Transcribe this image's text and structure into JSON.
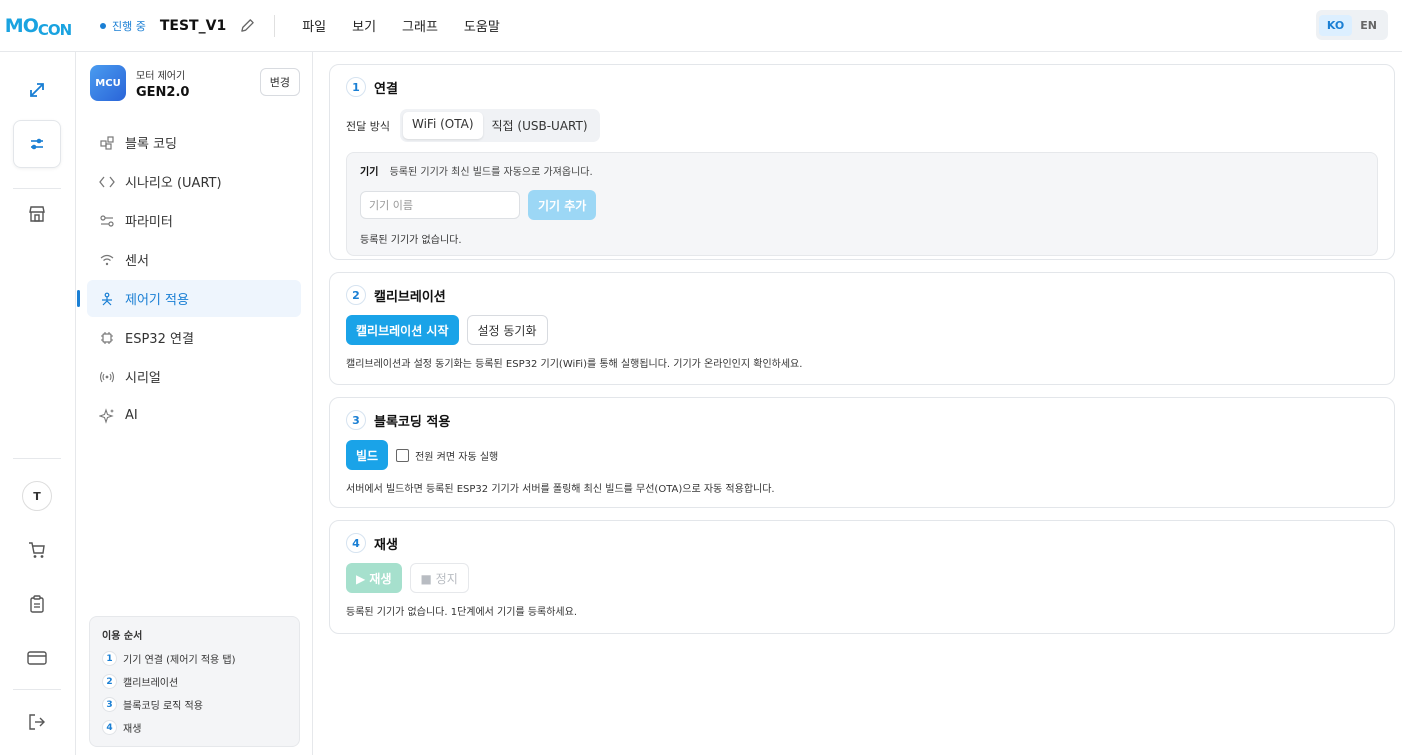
{
  "header": {
    "logo": "MOCON",
    "status": "진행 중",
    "project_title": "TEST_V1",
    "menu": [
      "파일",
      "보기",
      "그래프",
      "도움말"
    ],
    "lang": {
      "ko": "KO",
      "en": "EN",
      "active": "KO"
    }
  },
  "rail": {
    "items": [
      "chart-icon",
      "sliders-icon",
      "store-icon",
      "cart-icon",
      "clipboard-icon",
      "card-icon",
      "logout-icon"
    ],
    "avatar": "T"
  },
  "sidebar": {
    "device_badge": "MCU",
    "device_sub": "모터 제어기",
    "device_name": "GEN2.0",
    "change_label": "변경",
    "items": [
      {
        "label": "블록 코딩",
        "icon": "blocks-icon"
      },
      {
        "label": "시나리오 (UART)",
        "icon": "code-icon"
      },
      {
        "label": "파라미터",
        "icon": "sliders-icon"
      },
      {
        "label": "센서",
        "icon": "wifi-icon"
      },
      {
        "label": "제어기 적용",
        "icon": "apply-icon"
      },
      {
        "label": "ESP32 연결",
        "icon": "chip-icon"
      },
      {
        "label": "시리얼",
        "icon": "signal-icon"
      },
      {
        "label": "AI",
        "icon": "sparkle-icon"
      }
    ],
    "guide": {
      "title": "이용 순서",
      "steps": [
        {
          "num": "1",
          "text": "기기 연결 (제어기 적용 탭)"
        },
        {
          "num": "2",
          "text": "캘리브레이션"
        },
        {
          "num": "3",
          "text": "블록코딩 로직 적용"
        },
        {
          "num": "4",
          "text": "재생"
        }
      ]
    }
  },
  "main": {
    "step1": {
      "num": "1",
      "title": "연결",
      "method_label": "전달 방식",
      "methods": [
        "WiFi (OTA)",
        "직접 (USB-UART)"
      ],
      "device_label": "기기",
      "device_hint": "등록된 기기가 최신 빌드를 자동으로 가져옵니다.",
      "input_placeholder": "기기 이름",
      "add_button": "기기 추가",
      "empty": "등록된 기기가 없습니다."
    },
    "step2": {
      "num": "2",
      "title": "캘리브레이션",
      "start_button": "캘리브레이션 시작",
      "sync_button": "설정 동기화",
      "desc": "캘리브레이션과 설정 동기화는 등록된 ESP32 기기(WiFi)를 통해 실행됩니다. 기기가 온라인인지 확인하세요."
    },
    "step3": {
      "num": "3",
      "title": "블록코딩 적용",
      "build_button": "빌드",
      "autorun_label": "전원 켜면 자동 실행",
      "desc": "서버에서 빌드하면 등록된 ESP32 기기가 서버를 폴링해 최신 빌드를 무선(OTA)으로 자동 적용합니다."
    },
    "step4": {
      "num": "4",
      "title": "재생",
      "play_button": "▶ 재생",
      "stop_button": "■ 정지",
      "desc": "등록된 기기가 없습니다. 1단계에서 기기를 등록하세요."
    }
  }
}
